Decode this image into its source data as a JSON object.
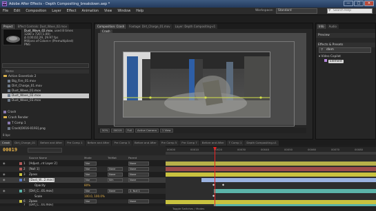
{
  "window": {
    "title": "Adobe After Effects - Depth Compositing_breakdown.aep *",
    "app_badge": "Ae",
    "min": "—",
    "max": "□",
    "close": "✕"
  },
  "menu": [
    "File",
    "Edit",
    "Composition",
    "Layer",
    "Effect",
    "Animation",
    "View",
    "Window",
    "Help"
  ],
  "workspace": {
    "label": "Workspace:",
    "value": "Standard"
  },
  "search_help": "Search Help",
  "project_panel": {
    "tabs": [
      "Project",
      "Effect Controls: Dust_Wave_02.mov"
    ],
    "selected_name": "Dust_Wave_02.mov",
    "selected_used": ", used 8 times",
    "info": [
      "1280 x 720 (1.00)",
      "Δ 0;00;02;29, 29.97 fps",
      "Millions of Colors+ (Premultiplied)",
      "PNG"
    ],
    "column_name": "Name",
    "items": [
      {
        "label": "Action Essentials 2",
        "type": "folder",
        "indent": 0
      },
      {
        "label": "Big_Fire_01.mov",
        "type": "footage",
        "indent": 1
      },
      {
        "label": "Dirt_Charge_01.mov",
        "type": "footage",
        "indent": 1
      },
      {
        "label": "Dust_Wave_01.mov",
        "type": "footage",
        "indent": 1
      },
      {
        "label": "Dust_Wave_02.mov",
        "type": "footage",
        "indent": 1,
        "selected": true
      },
      {
        "label": "Dust_Wave_03.mov",
        "type": "footage",
        "indent": 1
      },
      {
        "label": "Crash",
        "type": "comp",
        "indent": 0
      },
      {
        "label": "Crash Render",
        "type": "folder",
        "indent": 0
      },
      {
        "label": "T Comp 1",
        "type": "comp",
        "indent": 1
      },
      {
        "label": "Crash[0016-0193].png",
        "type": "footage",
        "indent": 1
      }
    ],
    "bottom": "8 bpc"
  },
  "composition_panel": {
    "tabs": [
      "Composition: Crash",
      "Footage: Dirt_Charge_01.mov",
      "Layer: Depth Compositing-v1"
    ],
    "subtab": "Crash",
    "zoom": "50%",
    "timecode": "00019",
    "resolution": "Full",
    "camera": "Active Camera",
    "views": "1 View"
  },
  "right_panels": {
    "info_tabs": [
      "Info",
      "Audio"
    ],
    "preview": "Preview",
    "effects_title": "Effects & Presets",
    "fx_search": "dlem",
    "category": "Video Copilot",
    "effect": "Element"
  },
  "timeline": {
    "tabs": [
      "Crash",
      "Dirt_Charge_01",
      "Before and After",
      "Pre Comp 1",
      "Before and After",
      "Pre Comp 3",
      "Before and After",
      "Pre Comp 5",
      "Pre Comp 7",
      "Before and After",
      "T Comp 1",
      "Depth Compositing-v1"
    ],
    "current_time": "00019",
    "columns": {
      "name": "Source Name",
      "mode": "Mode",
      "trkmat": "TrkMat",
      "parent": "Parent"
    },
    "ruler": [
      "00000",
      "00005",
      "00010",
      "00015",
      "00020",
      "00025",
      "00030",
      "00035",
      "00040",
      "00045",
      "00050",
      "00055",
      "00060",
      "00065",
      "00070",
      "00075",
      "00080",
      "00085"
    ],
    "layers": [
      {
        "num": "1",
        "name": "[Adjust...nt Layer 2]",
        "mode": "Nor",
        "trk": "",
        "parent": "None",
        "color": "#b35b5b"
      },
      {
        "num": "2",
        "name": "[Null 1]",
        "mode": "Nor",
        "trk": "None",
        "parent": "None",
        "color": "#b35b5b"
      },
      {
        "num": "3",
        "name": "Zpass",
        "mode": "Nor",
        "trk": "None",
        "parent": "None",
        "color": "#c9c23f"
      },
      {
        "num": "4",
        "name": "[Dust_W...2.mov]",
        "mode": "Nor",
        "trk": "Silh",
        "parent": "None",
        "color": "#5b7ec9",
        "selected": true
      },
      {
        "num": "",
        "name": "Opacity",
        "mode": "",
        "trk": "",
        "parent": "",
        "color": "",
        "value": "80%"
      },
      {
        "num": "5",
        "name": "[Dirt_C...01.mov]",
        "mode": "Nor",
        "trk": "None",
        "parent": "2. Null 1",
        "color": "#5bb3a8"
      },
      {
        "num": "",
        "name": "Scale",
        "mode": "",
        "trk": "",
        "parent": "",
        "color": "",
        "value": "100.0, 100.0%"
      },
      {
        "num": "6",
        "name": "Zpass",
        "mode": "Nor",
        "trk": "None",
        "parent": "None",
        "color": "#c9c23f"
      },
      {
        "num": "7",
        "name": "[Dirt_C...01.mov]",
        "mode": "Nor",
        "trk": "None",
        "parent": "2. Null 1",
        "color": "#5bb3a8"
      }
    ],
    "bottom": "Toggle Switches / Modes"
  }
}
